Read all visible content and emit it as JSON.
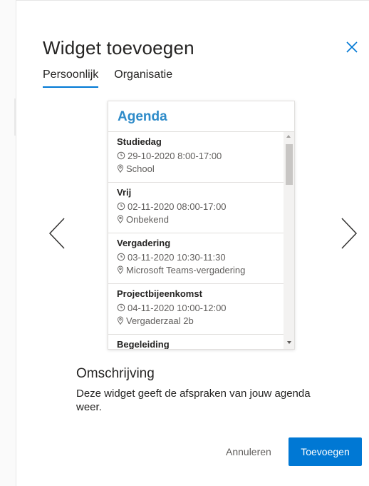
{
  "dialog": {
    "title": "Widget toevoegen",
    "close_icon": "close-icon"
  },
  "tabs": [
    {
      "label": "Persoonlijk",
      "active": true
    },
    {
      "label": "Organisatie",
      "active": false
    }
  ],
  "navigation": {
    "previous_icon": "chevron-left-icon",
    "next_icon": "chevron-right-icon"
  },
  "widget": {
    "title": "Agenda",
    "items": [
      {
        "title": "Studiedag",
        "time": "29-10-2020 8:00-17:00",
        "location": "School"
      },
      {
        "title": "Vrij",
        "time": "02-11-2020 08:00-17:00",
        "location": "Onbekend"
      },
      {
        "title": "Vergadering",
        "time": "03-11-2020 10:30-11:30",
        "location": "Microsoft Teams-vergadering"
      },
      {
        "title": "Projectbijeenkomst",
        "time": "04-11-2020 10:00-12:00",
        "location": "Vergaderzaal 2b"
      },
      {
        "title": "Begeleiding",
        "time": "",
        "location": ""
      }
    ]
  },
  "description": {
    "heading": "Omschrijving",
    "text": "Deze widget geeft de afspraken van jouw agenda weer."
  },
  "buttons": {
    "cancel_label": "Annuleren",
    "add_label": "Toevoegen"
  },
  "colors": {
    "accent": "#0078d4",
    "widget_title": "#2e8bc9"
  }
}
